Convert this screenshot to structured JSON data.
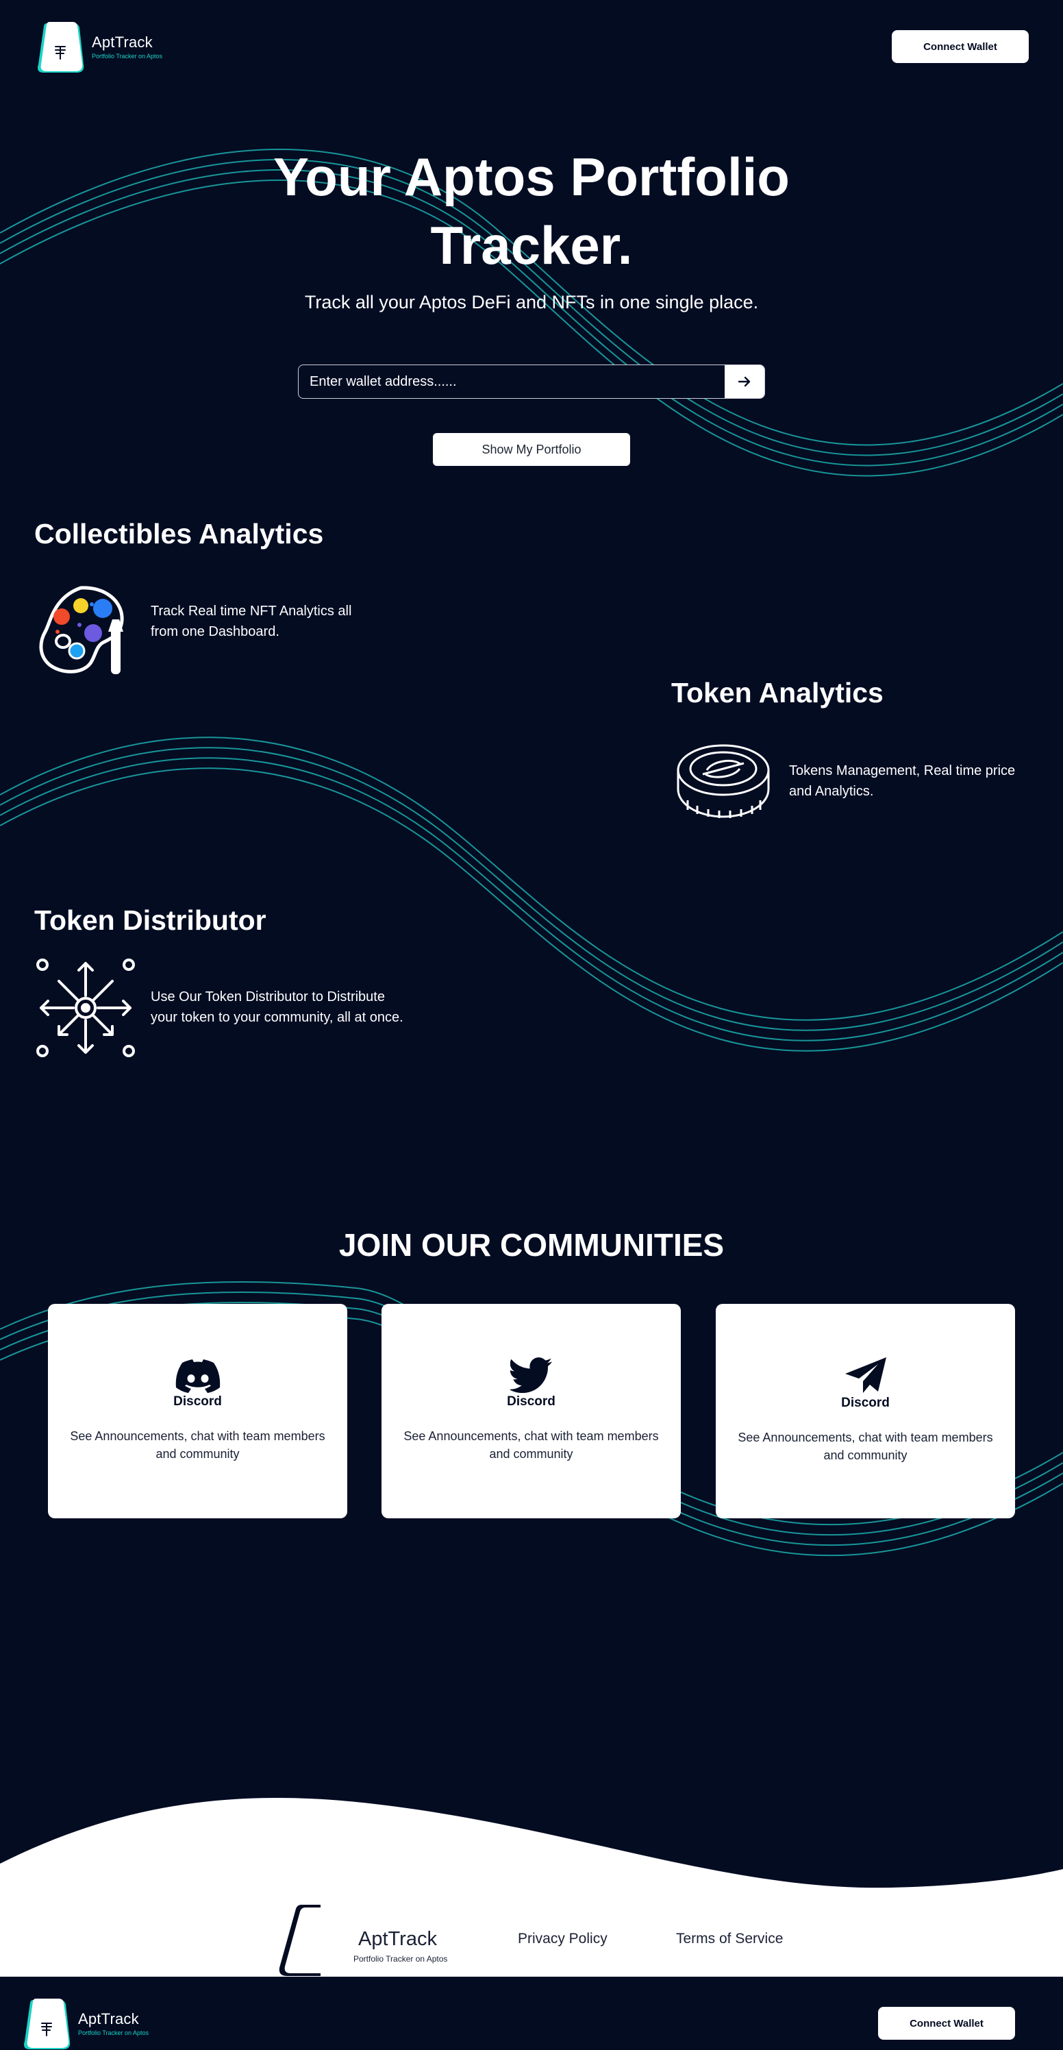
{
  "brand": {
    "name": "AptTrack",
    "tagline": "Portfolio Tracker on Aptos"
  },
  "header": {
    "connect_label": "Connect Wallet"
  },
  "hero": {
    "title_line1": "Your Aptos Portfolio",
    "title_line2": "Tracker.",
    "subtitle": "Track all your Aptos DeFi and NFTs in one single place.",
    "search_placeholder": "Enter wallet address......",
    "show_button": "Show My Portfolio"
  },
  "features": [
    {
      "title": "Collectibles Analytics",
      "desc_line1": "Track Real time NFT Analytics all",
      "desc_line2": "from one Dashboard.",
      "icon": "palette-icon"
    },
    {
      "title": "Token Analytics",
      "desc_line1": "Tokens Management, Real time price",
      "desc_line2": "and Analytics.",
      "icon": "coin-icon"
    },
    {
      "title": "Token Distributor",
      "desc_line1": "Use Our Token Distributor to Distribute",
      "desc_line2": "your token to your community, all at once.",
      "icon": "distribute-icon"
    }
  ],
  "communities": {
    "title": "JOIN OUR COMMUNITIES",
    "cards": [
      {
        "name": "Discord",
        "desc_line1": "See Announcements, chat with team members",
        "desc_line2": "and community",
        "icon": "discord-icon"
      },
      {
        "name": "Discord",
        "desc_line1": "See Announcements, chat with team members",
        "desc_line2": "and community",
        "icon": "twitter-icon"
      },
      {
        "name": "Discord",
        "desc_line1": "See Announcements, chat with team members",
        "desc_line2": "and community",
        "icon": "telegram-icon"
      }
    ]
  },
  "footer": {
    "privacy": "Privacy Policy",
    "terms": "Terms of Service",
    "connect_label": "Connect Wallet"
  },
  "colors": {
    "background": "#040c22",
    "accent": "#19d3c5",
    "wave": "#1ba5a5",
    "white": "#ffffff"
  }
}
